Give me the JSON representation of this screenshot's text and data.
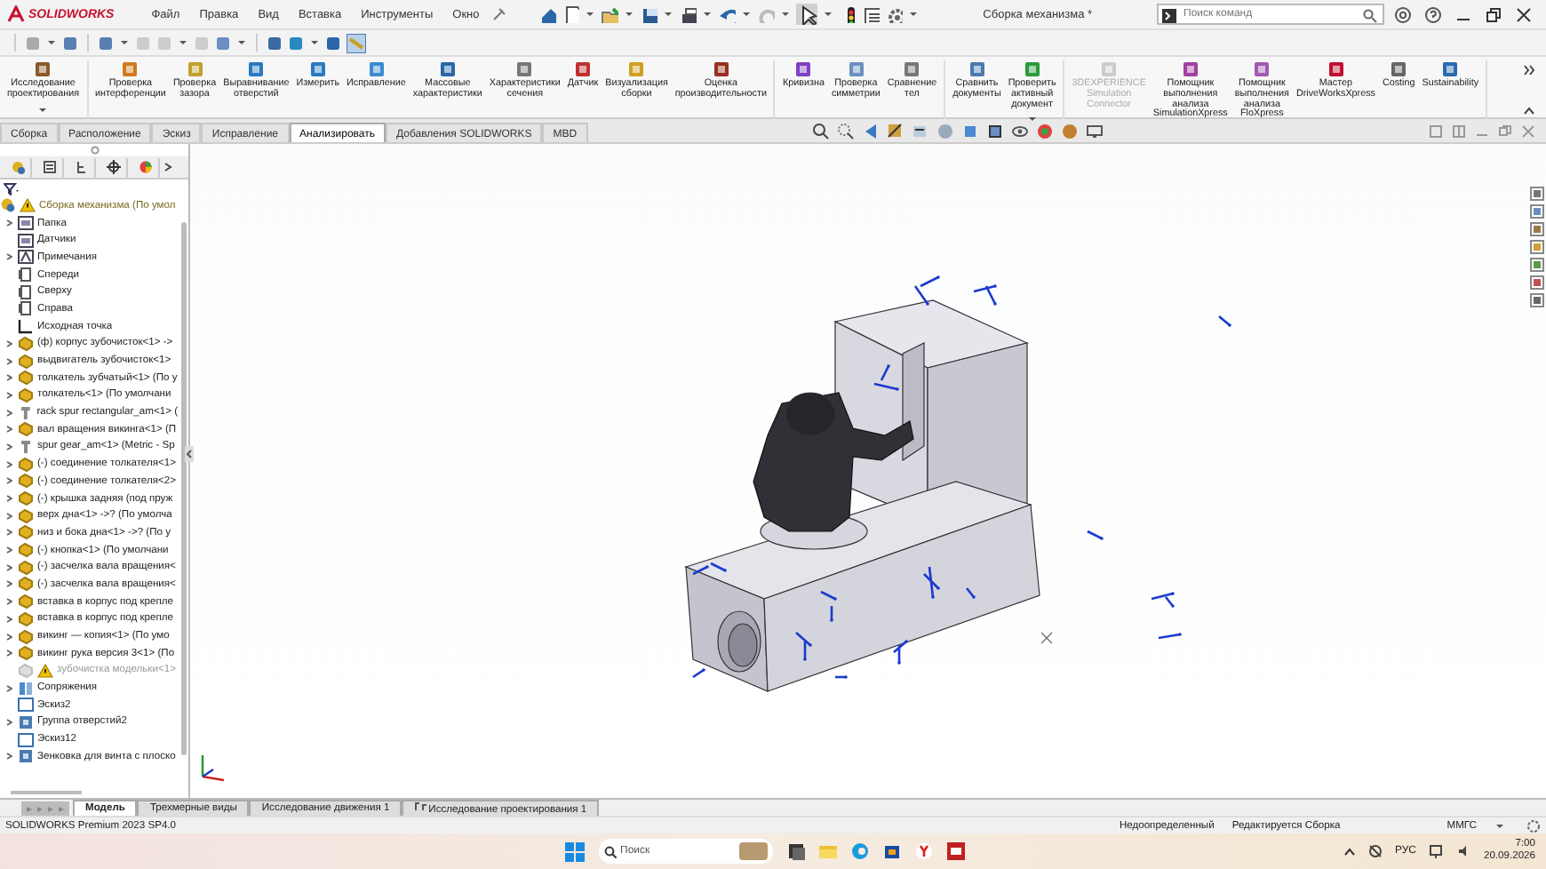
{
  "title_bar": {
    "app_name": "SOLIDWORKS",
    "menu": [
      "Файл",
      "Правка",
      "Вид",
      "Вставка",
      "Инструменты",
      "Окно"
    ],
    "document_title": "Сборка механизма *",
    "search": {
      "placeholder": "Поиск команд"
    }
  },
  "ribbon": {
    "groups": [
      {
        "buttons": [
          {
            "label": "Исследование проектирования",
            "dropdown": true,
            "disabled": false
          }
        ]
      },
      {
        "buttons": [
          {
            "label": "Проверка интерференции",
            "dropdown": false,
            "disabled": false
          },
          {
            "label": "Проверка зазора",
            "dropdown": false,
            "disabled": false
          },
          {
            "label": "Выравнивание отверстий",
            "dropdown": false,
            "disabled": false
          },
          {
            "label": "Измерить",
            "dropdown": false,
            "disabled": false
          },
          {
            "label": "Исправление",
            "dropdown": false,
            "disabled": false
          },
          {
            "label": "Массовые характеристики",
            "dropdown": false,
            "disabled": false
          },
          {
            "label": "Характеристики сечения",
            "dropdown": false,
            "disabled": false
          },
          {
            "label": "Датчик",
            "dropdown": false,
            "disabled": false
          },
          {
            "label": "Визуализация сборки",
            "dropdown": false,
            "disabled": false
          },
          {
            "label": "Оценка производительности",
            "dropdown": false,
            "disabled": false
          }
        ]
      },
      {
        "buttons": [
          {
            "label": "Кривизна",
            "dropdown": false,
            "disabled": false
          },
          {
            "label": "Проверка симметрии",
            "dropdown": false,
            "disabled": false
          },
          {
            "label": "Сравнение тел",
            "dropdown": false,
            "disabled": false
          }
        ]
      },
      {
        "buttons": [
          {
            "label": "Сравнить документы",
            "dropdown": false,
            "disabled": false
          },
          {
            "label": "Проверить активный документ",
            "dropdown": true,
            "disabled": false
          }
        ]
      },
      {
        "buttons": [
          {
            "label": "3DEXPERIENCE Simulation Connector",
            "dropdown": false,
            "disabled": true
          },
          {
            "label": "Помощник выполнения анализа SimulationXpress",
            "dropdown": false,
            "disabled": false
          },
          {
            "label": "Помощник выполнения анализа FloXpress",
            "dropdown": false,
            "disabled": false
          },
          {
            "label": "Мастер DriveWorksXpress",
            "dropdown": false,
            "disabled": false
          },
          {
            "label": "Costing",
            "dropdown": false,
            "disabled": false
          },
          {
            "label": "Sustainability",
            "dropdown": false,
            "disabled": false
          }
        ]
      }
    ]
  },
  "command_tabs": [
    {
      "label": "Сборка",
      "selected": false
    },
    {
      "label": "Расположение",
      "selected": false
    },
    {
      "label": "Эскиз",
      "selected": false
    },
    {
      "label": "Исправление",
      "selected": false
    },
    {
      "label": "Анализировать",
      "selected": true
    },
    {
      "label": "Добавления SOLIDWORKS",
      "selected": false
    },
    {
      "label": "MBD",
      "selected": false
    }
  ],
  "feature_tree": {
    "root": {
      "label": "Сборка механизма  (По умол",
      "warning": true,
      "children": [
        {
          "kind": "folder",
          "label": "Папка",
          "expandable": true
        },
        {
          "kind": "folder",
          "label": "Датчики",
          "expandable": false
        },
        {
          "kind": "annotation",
          "label": "Примечания",
          "expandable": true
        },
        {
          "kind": "plane",
          "label": "Спереди",
          "expandable": false
        },
        {
          "kind": "plane",
          "label": "Сверху",
          "expandable": false
        },
        {
          "kind": "plane",
          "label": "Справа",
          "expandable": false
        },
        {
          "kind": "origin",
          "label": "Исходная точка",
          "expandable": false
        },
        {
          "kind": "part",
          "label": "(ф) корпус зубочисток<1> ->",
          "expandable": true
        },
        {
          "kind": "part",
          "label": "выдвигатель зубочисток<1>",
          "expandable": true
        },
        {
          "kind": "part",
          "label": "толкатель зубчатый<1> (По у",
          "expandable": true
        },
        {
          "kind": "part",
          "label": "толкатель<1> (По умолчани",
          "expandable": true
        },
        {
          "kind": "library_part",
          "label": "rack spur rectangular_am<1> (",
          "expandable": true
        },
        {
          "kind": "part",
          "label": "вал вращения викинга<1> (П",
          "expandable": true
        },
        {
          "kind": "library_part",
          "label": "spur gear_am<1> (Metric - Sp",
          "expandable": true
        },
        {
          "kind": "part",
          "label": "(-) соединение толкателя<1>",
          "expandable": true
        },
        {
          "kind": "part",
          "label": "(-) соединение толкателя<2>",
          "expandable": true
        },
        {
          "kind": "part",
          "label": "(-) крышка задняя (под пруж",
          "expandable": true
        },
        {
          "kind": "part",
          "label": "верх дна<1> ->? (По умолча",
          "expandable": true
        },
        {
          "kind": "part",
          "label": "низ и бока дна<1> ->? (По у",
          "expandable": true
        },
        {
          "kind": "part",
          "label": "(-) кнопка<1> (По умолчани",
          "expandable": true
        },
        {
          "kind": "part",
          "label": "(-) засчелка вала вращения<",
          "expandable": true
        },
        {
          "kind": "part",
          "label": "(-) засчелка вала вращения<",
          "expandable": true
        },
        {
          "kind": "part",
          "label": "вставка в корпус под крепле",
          "expandable": true
        },
        {
          "kind": "part",
          "label": "вставка в корпус под крепле",
          "expandable": true
        },
        {
          "kind": "part",
          "label": "викинг — копия<1> (По умо",
          "expandable": true
        },
        {
          "kind": "part",
          "label": "викинг рука версия 3<1> (По",
          "expandable": true
        },
        {
          "kind": "suppressed_part",
          "label": "зубочистка модельки<1>",
          "expandable": false
        },
        {
          "kind": "mates",
          "label": "Сопряжения",
          "expandable": true
        },
        {
          "kind": "sketch",
          "label": "Эскиз2",
          "expandable": false
        },
        {
          "kind": "feature",
          "label": "Группа отверстий2",
          "expandable": true
        },
        {
          "kind": "sketch",
          "label": "Эскиз12",
          "expandable": false
        },
        {
          "kind": "feature",
          "label": "Зенковка для  винта с плоско",
          "expandable": true
        }
      ]
    }
  },
  "model_tabs": [
    {
      "label": "Модель",
      "selected": true
    },
    {
      "label": "Трехмерные виды",
      "selected": false
    },
    {
      "label": "Исследование движения 1",
      "selected": false
    },
    {
      "label": "Исследование проектирования 1",
      "selected": false
    }
  ],
  "status_bar": {
    "product": "SOLIDWORKS Premium 2023 SP4.0",
    "definition": "Недоопределенный",
    "editing": "Редактируется Сборка",
    "units": "ММГС"
  },
  "taskbar": {
    "search": {
      "placeholder": "Поиск"
    },
    "language": "РУС",
    "time": "7:00",
    "date": "20.09.2026"
  }
}
